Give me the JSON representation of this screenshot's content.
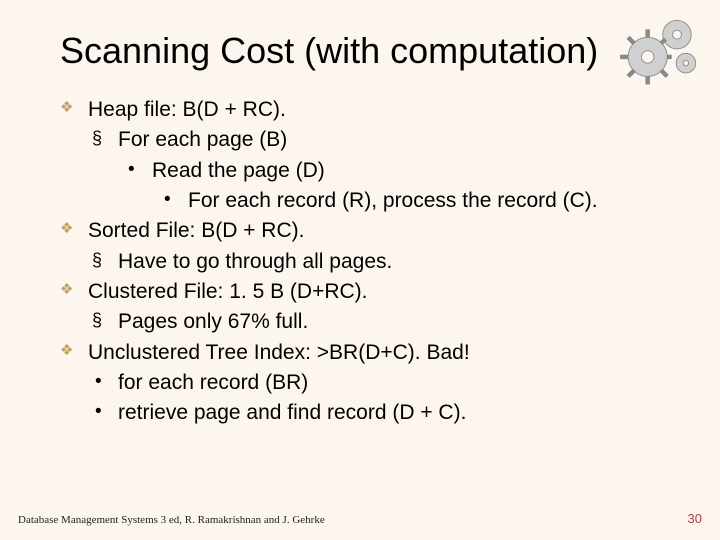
{
  "title": "Scanning Cost (with computation)",
  "bullets": {
    "b1": "Heap file: B(D + RC).",
    "b1a": "For each page (B)",
    "b1a1": "Read the page (D)",
    "b1a1a": "For each record (R), process the record (C).",
    "b2": "Sorted File: B(D + RC).",
    "b2a": "Have to go through all pages.",
    "b3": "Clustered File: 1. 5 B (D+RC).",
    "b3a": "Pages only 67% full.",
    "b4": "Unclustered Tree Index: >BR(D+C). Bad!",
    "b4a": "for each record (BR)",
    "b4b": "retrieve page and find record (D + C)."
  },
  "footer": {
    "left": "Database Management Systems 3 ed, R. Ramakrishnan and J. Gehrke",
    "right": "30"
  }
}
